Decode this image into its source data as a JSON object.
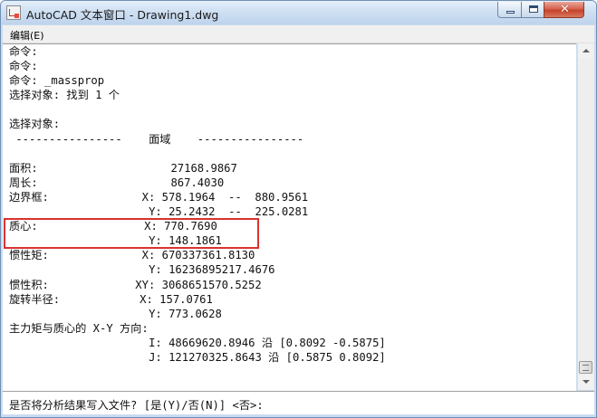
{
  "window": {
    "title": "AutoCAD 文本窗口 - Drawing1.dwg",
    "close_glyph": "✕"
  },
  "menu": {
    "items": [
      {
        "label": "编辑(E)"
      }
    ]
  },
  "output": {
    "lines": [
      "命令:",
      "命令:",
      "命令: _massprop",
      "选择对象: 找到 1 个",
      "",
      "选择对象:",
      " ----------------    面域    ----------------",
      "",
      "面积:                    27168.9867",
      "周长:                    867.4030",
      "边界框:              X: 578.1964  --  880.9561",
      "                     Y: 25.2432  --  225.0281",
      "质心:                X: 770.7690",
      "                     Y: 148.1861",
      "惯性矩:              X: 670337361.8130",
      "                     Y: 16236895217.4676",
      "惯性积:             XY: 3068651570.5252",
      "旋转半径:            X: 157.0761",
      "                     Y: 773.0628",
      "主力矩与质心的 X-Y 方向:",
      "                     I: 48669620.8946 沿 [0.8092 -0.5875]",
      "                     J: 121270325.8643 沿 [0.5875 0.8092]",
      "",
      ""
    ]
  },
  "command_prompt": "是否将分析结果写入文件? [是(Y)/否(N)] <否>:",
  "annotation": {
    "highlight_color": "#d9332f"
  }
}
